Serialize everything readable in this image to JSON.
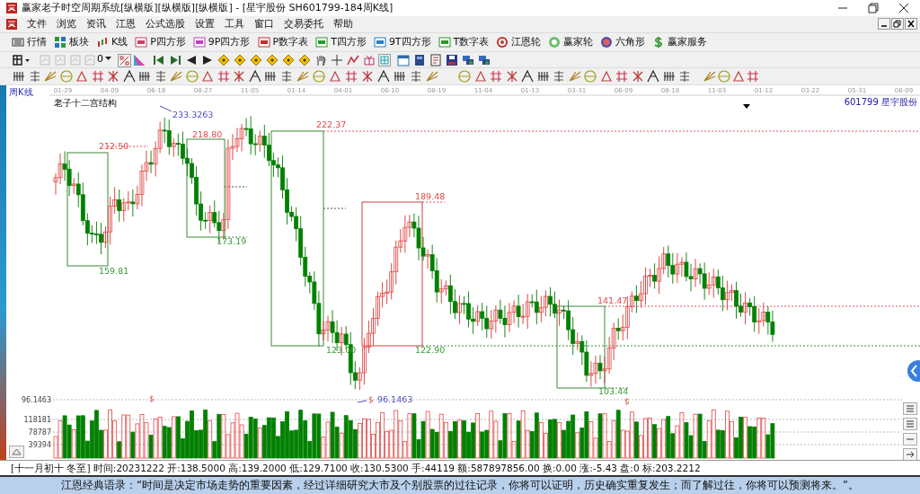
{
  "window": {
    "title": "赢家老子时空周期系统[纵横版][纵横版][纵横版] - [星宇股份  SH601799-184周K线]"
  },
  "menu": [
    "文件",
    "浏览",
    "资讯",
    "江恩",
    "公式选股",
    "设置",
    "工具",
    "窗口",
    "交易委托",
    "帮助"
  ],
  "toolbar": [
    "行情",
    "板块",
    "K线",
    "P四方形",
    "9P四方形",
    "P数字表",
    "T四方形",
    "9T四方形",
    "T数字表",
    "江恩轮",
    "赢家轮",
    "六角形",
    "赢家服务"
  ],
  "period_select": {
    "value": "0"
  },
  "chart": {
    "period_label": "周K线",
    "indicator_title": "老子十二宫结构",
    "stock": "601799  星宇股份",
    "dates": [
      "01-29",
      "04-09",
      "06-18",
      "08-27",
      "11-05",
      "01-14",
      "04-01",
      "06-10",
      "08-19",
      "11-04",
      "01-13",
      "03-31",
      "06-09",
      "08-18",
      "11-03",
      "01-12",
      "03-22",
      "05-31",
      "08-09"
    ],
    "price_labels": [
      {
        "text": "233.3263",
        "color": "#5050c0"
      },
      {
        "text": "222.37",
        "color": "#e04848"
      },
      {
        "text": "218.80",
        "color": "#e04848"
      },
      {
        "text": "212.50",
        "color": "#e04848"
      },
      {
        "text": "189.48",
        "color": "#e04848"
      },
      {
        "text": "173.19",
        "color": "#3a9a3a"
      },
      {
        "text": "159.81",
        "color": "#3a9a3a"
      },
      {
        "text": "141.47",
        "color": "#e04848"
      },
      {
        "text": "123.00",
        "color": "#3a9a3a"
      },
      {
        "text": "122.90",
        "color": "#3a9a3a"
      },
      {
        "text": "103.44",
        "color": "#3a9a3a"
      },
      {
        "text": "96.1463",
        "color": "#5050c0"
      }
    ],
    "markers": [
      "$",
      "$",
      "$"
    ],
    "volume_axis": [
      "96.1463",
      "118181",
      "78787",
      "39394"
    ]
  },
  "status_bar": "[十一月初十 冬至] 时间:20231222 开:138.5000 高:139.2000 低:129.7100 收:130.5300 手:44119 额:587897856.00 换:0.00 涨:-5.43 盘:0 标:203.2212",
  "quote": "江恩经典语录：“时间是决定市场走势的重要因素，经过详细研究大市及个别股票的过往记录，你将可以证明，历史确实重复发生；而了解过往，你将可以预测将来。”。"
}
